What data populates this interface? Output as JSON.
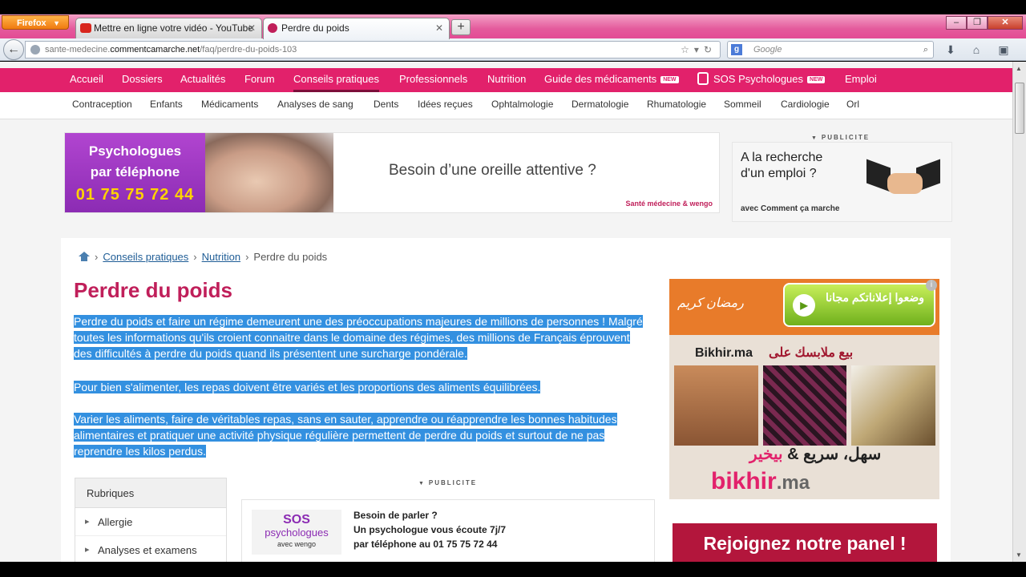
{
  "browser": {
    "app_button": "Firefox",
    "tabs": [
      {
        "label": "Mettre en ligne votre vidéo - YouTube",
        "favicon_color": "#d8261d"
      },
      {
        "label": "Perdre du poids",
        "favicon_color": "#c01f5a"
      }
    ],
    "url_prefix": "sante-medecine.",
    "url_host": "commentcamarche.net",
    "url_path": "/faq/perdre-du-poids-103",
    "search_placeholder": "Google",
    "search_engine_letter": "g",
    "icons": [
      "back-icon",
      "star-icon",
      "reload-icon",
      "download-icon",
      "home-icon",
      "addon-icon"
    ]
  },
  "main_nav": {
    "items": [
      "Accueil",
      "Dossiers",
      "Actualités",
      "Forum",
      "Conseils pratiques",
      "Professionnels",
      "Nutrition",
      "Guide des médicaments",
      "SOS Psychologues",
      "Emploi"
    ],
    "new_badge": "NEW",
    "current": "Conseils pratiques",
    "color": "#e2216b"
  },
  "sub_nav": {
    "items": [
      "Contraception",
      "Enfants",
      "Médicaments",
      "Analyses de sang",
      "Dents",
      "Idées reçues",
      "Ophtalmologie",
      "Dermatologie",
      "Rhumatologie",
      "Sommeil",
      "Cardiologie",
      "Orl"
    ]
  },
  "top_banner": {
    "left_text_1": "Psychologues",
    "left_text_2": "par téléphone",
    "phone": "01 75 75 72 44",
    "headline": "Besoin d’une oreille attentive ?",
    "logos": "Santé médecine & wengo"
  },
  "publicite_label": "PUBLICITE",
  "side_ad": {
    "text_1": "A la recherche",
    "text_2": "d'un emploi ?",
    "avec": "avec Comment ça marche"
  },
  "breadcrumb": {
    "items": [
      "Conseils pratiques",
      "Nutrition"
    ],
    "current": "Perdre du poids"
  },
  "article": {
    "title": "Perdre du poids",
    "paragraphs": [
      "Perdre du poids et faire un régime demeurent une des préoccupations majeures de millions de personnes ! Malgré toutes les informations qu'ils croient connaitre dans le domaine des régimes, des millions de Français éprouvent des difficultés à perdre du poids quand ils présentent une surcharge pondérale.",
      "Pour bien s'alimenter, les repas doivent être variés et les proportions des aliments équilibrées.",
      "Varier les aliments, faire de véritables repas, sans en sauter, apprendre ou réapprendre les bonnes habitudes alimentaires et pratiquer une activité physique régulière permettent de perdre du poids et surtout de ne pas reprendre les kilos perdus."
    ],
    "selection_color": "#3390e0",
    "title_color": "#c01f5a"
  },
  "rubriques": {
    "header": "Rubriques",
    "items": [
      "Allergie",
      "Analyses et examens"
    ]
  },
  "sos_box": {
    "logo_line_1": "SOS",
    "logo_line_2": "psychologues",
    "logo_line_3": "avec wengo",
    "line_1": "Besoin de parler ?",
    "line_2": "Un psychologue vous écoute 7j/7",
    "line_3": "par téléphone au 01 75 75 72 44"
  },
  "bikhir_ad": {
    "ramadan": "رمضان كريم",
    "pill": "وضعوا إعلاناتكم مجانا",
    "site": "Bikhir.ma",
    "arabic_1": "بيع ملابسك على",
    "tagline_a": "سهل، سريع & ",
    "tagline_b": "بيخير",
    "brand": "bikhir",
    "brand_tld": ".ma",
    "info": "i"
  },
  "panel_ad": {
    "text": "Rejoignez notre panel !"
  }
}
